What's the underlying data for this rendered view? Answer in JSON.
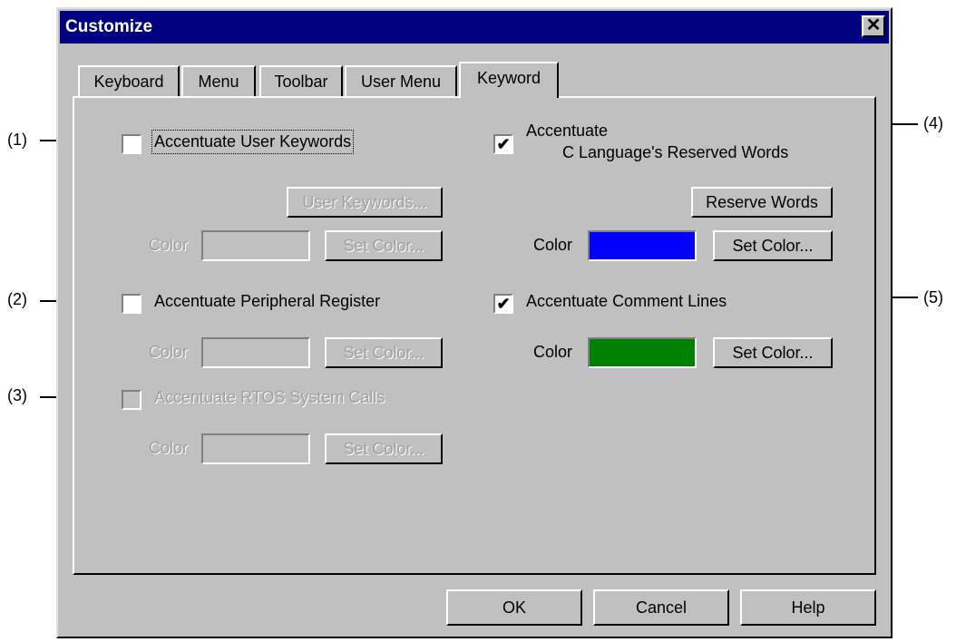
{
  "window": {
    "title": "Customize",
    "close_glyph": "✕"
  },
  "tabs": [
    {
      "label": "Keyboard"
    },
    {
      "label": "Menu"
    },
    {
      "label": "Toolbar"
    },
    {
      "label": "User Menu"
    },
    {
      "label": "Keyword",
      "active": true
    }
  ],
  "left": {
    "user_keywords": {
      "checkbox_label": "Accentuate User Keywords",
      "checked": false,
      "button": "User Keywords...",
      "color_label": "Color",
      "set_color": "Set Color..."
    },
    "peripheral": {
      "checkbox_label": "Accentuate Peripheral Register",
      "checked": false,
      "color_label": "Color",
      "set_color": "Set Color..."
    },
    "rtos": {
      "checkbox_label": "Accentuate RTOS System Calls",
      "checked": false,
      "disabled": true,
      "color_label": "Color",
      "set_color": "Set Color..."
    }
  },
  "right": {
    "reserved": {
      "checkbox_label_line1": "Accentuate",
      "checkbox_label_line2": "C Language's Reserved Words",
      "checked": true,
      "check_glyph": "✔",
      "button": "Reserve Words",
      "color_label": "Color",
      "color": "#0000ff",
      "set_color": "Set Color..."
    },
    "comments": {
      "checkbox_label": "Accentuate Comment Lines",
      "checked": true,
      "check_glyph": "✔",
      "color_label": "Color",
      "color": "#008000",
      "set_color": "Set Color..."
    }
  },
  "footer": {
    "ok": "OK",
    "cancel": "Cancel",
    "help": "Help"
  },
  "annotations": [
    "(1)",
    "(2)",
    "(3)",
    "(4)",
    "(5)"
  ]
}
